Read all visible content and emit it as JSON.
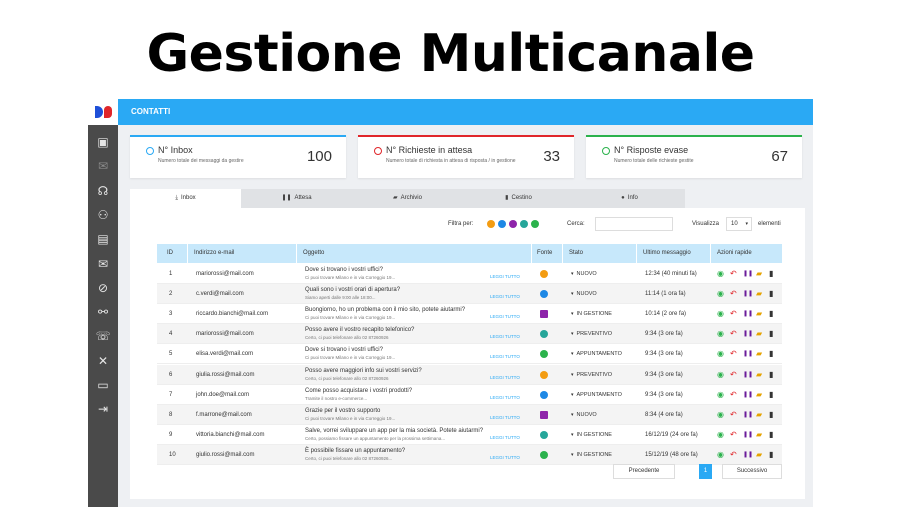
{
  "page_title": "Gestione Multicanale",
  "topbar": {
    "title": "CONTATTI"
  },
  "sidebar": {
    "icons": [
      "image-icon",
      "mail-icon",
      "headset-icon",
      "group-icon",
      "book-icon",
      "mail-settings-icon",
      "compass-icon",
      "network-icon",
      "chat-icon",
      "tools-icon",
      "screen-icon",
      "logout-icon"
    ],
    "glyphs": [
      "▣",
      "✉",
      "☊",
      "⚇",
      "▤",
      "✉",
      "⊘",
      "⚯",
      "☏",
      "✕",
      "▭",
      "⇥"
    ]
  },
  "cards": [
    {
      "title": "N° Inbox",
      "subtitle": "Numero totale dei messaggi da gestire",
      "value": "100",
      "color": "#2aa9f4",
      "icon": "check-circle-icon"
    },
    {
      "title": "N° Richieste in attesa",
      "subtitle": "Numero totale di richiesta in attesa di risposta / in gestione",
      "value": "33",
      "color": "#e0262a",
      "icon": "check-circle-icon"
    },
    {
      "title": "N° Risposte evase",
      "subtitle": "Numero totale delle richieste gestite",
      "value": "67",
      "color": "#2bb24c",
      "icon": "check-circle-icon"
    }
  ],
  "tabs": [
    {
      "label": "Inbox",
      "icon": "download-icon",
      "glyph": "⤓"
    },
    {
      "label": "Attesa",
      "icon": "pause-icon",
      "glyph": "❚❚"
    },
    {
      "label": "Archivio",
      "icon": "folder-open-icon",
      "glyph": "▰"
    },
    {
      "label": "Cestino",
      "icon": "trash-icon",
      "glyph": "▮"
    },
    {
      "label": "Info",
      "icon": "info-icon",
      "glyph": "●"
    }
  ],
  "toolbar": {
    "filter_label": "Filtra per:",
    "search_label": "Cerca:",
    "search_value": "",
    "show_label": "Visualizza",
    "show_value": "10",
    "show_suffix": "elementi",
    "filter_channels": [
      {
        "name": "chat-filter-icon",
        "color": "#f39c12"
      },
      {
        "name": "messenger-filter-icon",
        "color": "#1e88e5"
      },
      {
        "name": "email-filter-icon",
        "color": "#8e24aa"
      },
      {
        "name": "sms-filter-icon",
        "color": "#26a69a"
      },
      {
        "name": "whatsapp-filter-icon",
        "color": "#2bb24c"
      }
    ]
  },
  "table": {
    "headers": [
      "ID",
      "Indirizzo e-mail",
      "Oggetto",
      "Fonte",
      "Stato",
      "Ultimo messaggio",
      "Azioni rapide"
    ],
    "read_all_label": "LEGGI TUTTO",
    "rows": [
      {
        "id": "1",
        "email": "mariorossi@mail.com",
        "subject": "Dove si trovano i vostri uffici?",
        "preview": "Ci puoi trovare Milano e in via Correggio 19...",
        "source": "chat",
        "source_color": "#f39c12",
        "status": "NUOVO",
        "last": "12:34 (40 minuti fa)"
      },
      {
        "id": "2",
        "email": "c.verdi@mail.com",
        "subject": "Quali sono i vostri orari di apertura?",
        "preview": "Siamo aperti dalle 9:00 alle 18:00...",
        "source": "messenger",
        "source_color": "#1e88e5",
        "status": "NUOVO",
        "last": "11:14 (1 ora fa)"
      },
      {
        "id": "3",
        "email": "riccardo.bianchi@mail.com",
        "subject": "Buongiorno, ho un problema con il mio sito, potete aiutarmi?",
        "preview": "Ci puoi trovare Milano e in via Correggio 19...",
        "source": "email",
        "source_color": "#8e24aa",
        "status": "IN GESTIONE",
        "last": "10:14 (2 ore fa)"
      },
      {
        "id": "4",
        "email": "mariorossi@mail.com",
        "subject": "Posso avere il vostro recapito telefonico?",
        "preview": "Certo, ci puoi telefonare allo 02 87260926",
        "source": "sms",
        "source_color": "#26a69a",
        "status": "PREVENTIVO",
        "last": "9:34 (3 ore fa)"
      },
      {
        "id": "5",
        "email": "elisa.verdi@mail.com",
        "subject": "Dove si trovano i vostri uffici?",
        "preview": "Ci puoi trovare Milano e in via Correggio 19...",
        "source": "whatsapp",
        "source_color": "#2bb24c",
        "status": "APPUNTAMENTO",
        "last": "9:34 (3 ore fa)"
      },
      {
        "id": "6",
        "email": "giulia.rossi@mail.com",
        "subject": "Posso avere maggiori info sui vostri servizi?",
        "preview": "Certo, ci puoi telefonare allo 02 87260926",
        "source": "chat",
        "source_color": "#f39c12",
        "status": "PREVENTIVO",
        "last": "9:34 (3 ore fa)"
      },
      {
        "id": "7",
        "email": "john.doe@mail.com",
        "subject": "Come posso acquistare i vostri prodotti?",
        "preview": "Tramite il nostro e-commerce...",
        "source": "messenger",
        "source_color": "#1e88e5",
        "status": "APPUNTAMENTO",
        "last": "9:34 (3 ore fa)"
      },
      {
        "id": "8",
        "email": "f.marrone@mail.com",
        "subject": "Grazie per il vostro supporto",
        "preview": "Ci puoi trovare Milano e in via Correggio 19...",
        "source": "email",
        "source_color": "#8e24aa",
        "status": "NUOVO",
        "last": "8:34 (4 ore fa)"
      },
      {
        "id": "9",
        "email": "vittoria.bianchi@mail.com",
        "subject": "Salve, vorrei sviluppare un app per la mia società. Potete aiutarmi?",
        "preview": "Certo, possiamo fissare un appuntamento per la prossima settimana...",
        "source": "sms",
        "source_color": "#26a69a",
        "status": "IN GESTIONE",
        "last": "16/12/19 (24 ore fa)"
      },
      {
        "id": "10",
        "email": "giulio.rossi@mail.com",
        "subject": "È possibile fissare un appuntamento?",
        "preview": "Certo, ci puoi telefonare allo 02 87260926...",
        "source": "whatsapp",
        "source_color": "#2bb24c",
        "status": "IN GESTIONE",
        "last": "15/12/19 (48 ore fa)"
      }
    ],
    "actions": [
      {
        "name": "view-icon",
        "glyph": "◉",
        "color": "#2bb24c"
      },
      {
        "name": "reply-icon",
        "glyph": "↶",
        "color": "#e0262a"
      },
      {
        "name": "pause-icon",
        "glyph": "❚❚",
        "color": "#6a1b9a"
      },
      {
        "name": "archive-folder-icon",
        "glyph": "▰",
        "color": "#e6a300"
      },
      {
        "name": "trash-icon",
        "glyph": "▮",
        "color": "#333333"
      }
    ]
  },
  "pagination": {
    "prev": "Precedente",
    "current": "1",
    "next": "Successivo"
  }
}
